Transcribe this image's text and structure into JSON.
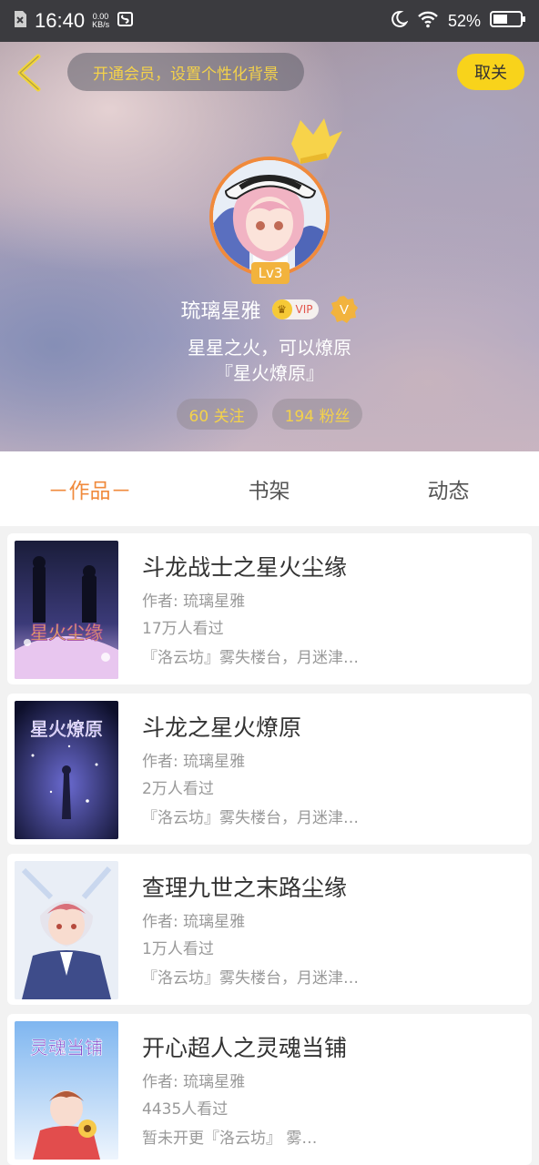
{
  "status_bar": {
    "time": "16:40",
    "speed_value": "0.00",
    "speed_unit": "KB/s",
    "battery": "52%"
  },
  "header": {
    "banner_text": "开通会员，设置个性化背景",
    "cancel_label": "取关"
  },
  "profile": {
    "level": "Lv3",
    "username": "琉璃星雅",
    "vip_label": "VIP",
    "verified_label": "V",
    "bio_line1": "星星之火，可以燎原",
    "bio_line2": "『星火燎原』",
    "following": "60 关注",
    "followers": "194 粉丝"
  },
  "tabs": [
    {
      "label": "－作品－",
      "active": true
    },
    {
      "label": "书架",
      "active": false
    },
    {
      "label": "动态",
      "active": false
    }
  ],
  "works": [
    {
      "title": "斗龙战士之星火尘缘",
      "author": "作者: 琉璃星雅",
      "views": "17万人看过",
      "desc": "『洛云坊』雾失楼台，月迷津…",
      "cover_text": "星火尘缘"
    },
    {
      "title": "斗龙之星火燎原",
      "author": "作者: 琉璃星雅",
      "views": "2万人看过",
      "desc": "『洛云坊』雾失楼台，月迷津…",
      "cover_text": "星火燎原"
    },
    {
      "title": "查理九世之末路尘缘",
      "author": "作者: 琉璃星雅",
      "views": "1万人看过",
      "desc": "『洛云坊』雾失楼台，月迷津…",
      "cover_text": ""
    },
    {
      "title": "开心超人之灵魂当铺",
      "author": "作者: 琉璃星雅",
      "views": "4435人看过",
      "desc": "暂未开更『洛云坊』 雾…",
      "cover_text": "灵魂当铺"
    }
  ],
  "colors": {
    "accent": "#f08a3c",
    "banner_text": "#f4d24a",
    "cancel_bg": "#f8d31b"
  }
}
